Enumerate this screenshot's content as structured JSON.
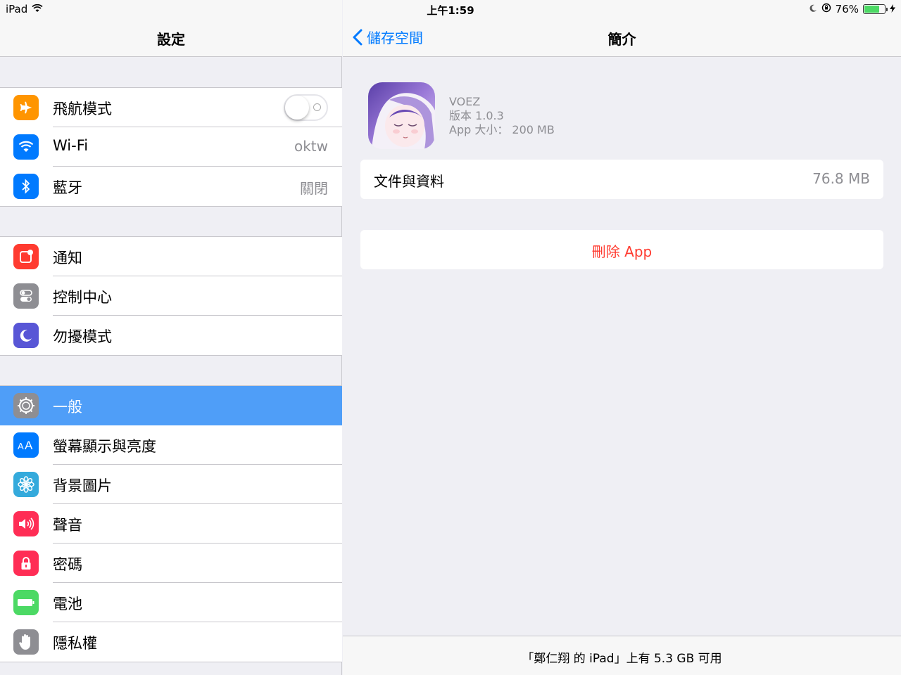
{
  "status_bar": {
    "device": "iPad",
    "time": "上午1:59",
    "battery": "76%",
    "battery_level": 0.76
  },
  "sidebar": {
    "title": "設定",
    "groups": [
      {
        "items": [
          {
            "label": "飛航模式",
            "icon": "airplane-icon",
            "color": "#ff9500",
            "toggle": false
          },
          {
            "label": "Wi-Fi",
            "icon": "wifi-icon",
            "color": "#007aff",
            "detail": "oktw"
          },
          {
            "label": "藍牙",
            "icon": "bluetooth-icon",
            "color": "#007aff",
            "detail": "關閉"
          }
        ]
      },
      {
        "items": [
          {
            "label": "通知",
            "icon": "notifications-icon",
            "color": "#ff3b30"
          },
          {
            "label": "控制中心",
            "icon": "control-center-icon",
            "color": "#8e8e93"
          },
          {
            "label": "勿擾模式",
            "icon": "moon-icon",
            "color": "#5856d6"
          }
        ]
      },
      {
        "items": [
          {
            "label": "一般",
            "icon": "gear-icon",
            "color": "#8e8e93",
            "selected": true
          },
          {
            "label": "螢幕顯示與亮度",
            "icon": "display-aa-icon",
            "color": "#007aff"
          },
          {
            "label": "背景圖片",
            "icon": "wallpaper-flower-icon",
            "color": "#34aadc"
          },
          {
            "label": "聲音",
            "icon": "speaker-icon",
            "color": "#ff2d55"
          },
          {
            "label": "密碼",
            "icon": "lock-icon",
            "color": "#ff2d55"
          },
          {
            "label": "電池",
            "icon": "battery-icon",
            "color": "#4cd964"
          },
          {
            "label": "隱私權",
            "icon": "hand-icon",
            "color": "#8e8e93"
          }
        ]
      }
    ]
  },
  "detail": {
    "back_label": "儲存空間",
    "title": "簡介",
    "app": {
      "name": "VOEZ",
      "version": "版本 1.0.3",
      "size": "App 大小： 200 MB"
    },
    "documents": {
      "label": "文件與資料",
      "value": "76.8 MB"
    },
    "delete_label": "刪除 App",
    "footer": "「鄭仁翔 的 iPad」上有 5.3 GB 可用"
  }
}
